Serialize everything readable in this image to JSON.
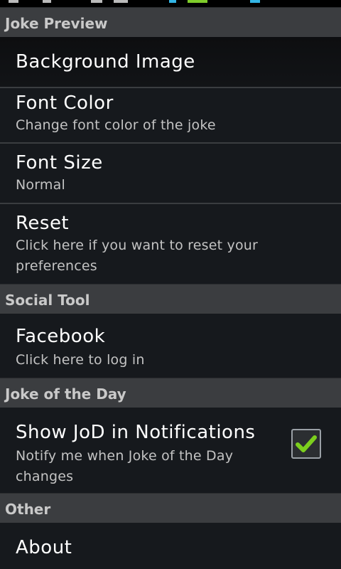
{
  "colors": {
    "background": "#16191d",
    "header_bg": "#3b3d40",
    "header_text": "#c9c9c9",
    "accent_check": "#7ccf1d",
    "status_blue": "#33b5e5"
  },
  "status_bar": {
    "icons": [
      "notification-icon",
      "notification-icon",
      "notification-icon",
      "notification-icon",
      "bluetooth-icon",
      "signal-icon",
      "battery-icon"
    ]
  },
  "sections": [
    {
      "header": "Joke Preview",
      "items": [
        {
          "title": "Background Image"
        },
        {
          "title": "Font Color",
          "summary": "Change font color of the joke"
        },
        {
          "title": "Font Size",
          "summary": "Normal"
        },
        {
          "title": "Reset",
          "summary_lines": [
            "Click here if you want to reset your",
            "preferences"
          ]
        }
      ]
    },
    {
      "header": "Social Tool",
      "items": [
        {
          "title": "Facebook",
          "summary": "Click here to log in"
        }
      ]
    },
    {
      "header": "Joke of the Day",
      "items": [
        {
          "title": "Show JoD in Notifications",
          "summary_lines": [
            "Notify me when Joke of the Day",
            "changes"
          ],
          "checked": true
        }
      ]
    },
    {
      "header": "Other",
      "items": [
        {
          "title": "About"
        }
      ]
    }
  ]
}
